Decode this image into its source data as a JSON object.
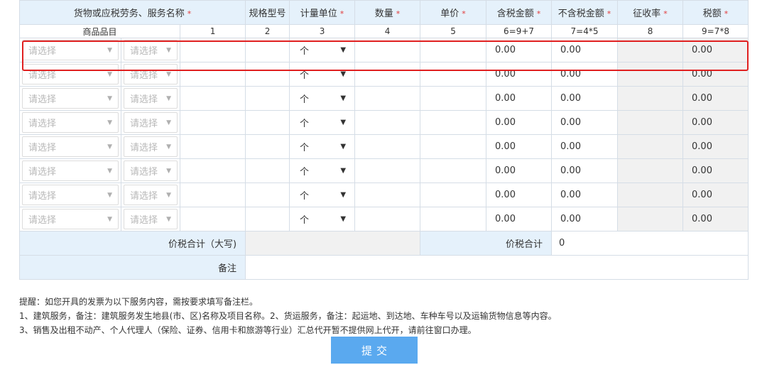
{
  "headers": [
    {
      "label": "货物或应税劳务、服务名称",
      "required": true
    },
    {
      "label": "规格型号",
      "required": false
    },
    {
      "label": "计量单位",
      "required": true
    },
    {
      "label": "数量",
      "required": true
    },
    {
      "label": "单价",
      "required": true
    },
    {
      "label": "含税金额",
      "required": true
    },
    {
      "label": "不含税金额",
      "required": true
    },
    {
      "label": "征收率",
      "required": true
    },
    {
      "label": "税额",
      "required": true
    }
  ],
  "required_mark": "*",
  "index_row": [
    "商品品目",
    "1",
    "2",
    "3",
    "4",
    "5",
    "6=9+7",
    "7=4*5",
    "8",
    "9=7*8"
  ],
  "rows": [
    {
      "cat1": "请选择",
      "cat2": "请选择",
      "unit": "个",
      "tax_incl": "0.00",
      "tax_excl": "0.00",
      "tax": "0.00"
    },
    {
      "cat1": "请选择",
      "cat2": "请选择",
      "unit": "个",
      "tax_incl": "0.00",
      "tax_excl": "0.00",
      "tax": "0.00"
    },
    {
      "cat1": "请选择",
      "cat2": "请选择",
      "unit": "个",
      "tax_incl": "0.00",
      "tax_excl": "0.00",
      "tax": "0.00"
    },
    {
      "cat1": "请选择",
      "cat2": "请选择",
      "unit": "个",
      "tax_incl": "0.00",
      "tax_excl": "0.00",
      "tax": "0.00"
    },
    {
      "cat1": "请选择",
      "cat2": "请选择",
      "unit": "个",
      "tax_incl": "0.00",
      "tax_excl": "0.00",
      "tax": "0.00"
    },
    {
      "cat1": "请选择",
      "cat2": "请选择",
      "unit": "个",
      "tax_incl": "0.00",
      "tax_excl": "0.00",
      "tax": "0.00"
    },
    {
      "cat1": "请选择",
      "cat2": "请选择",
      "unit": "个",
      "tax_incl": "0.00",
      "tax_excl": "0.00",
      "tax": "0.00"
    },
    {
      "cat1": "请选择",
      "cat2": "请选择",
      "unit": "个",
      "tax_incl": "0.00",
      "tax_excl": "0.00",
      "tax": "0.00"
    }
  ],
  "totals": {
    "uppercase_label": "价税合计（大写)",
    "total_label": "价税合计",
    "total_value": "0"
  },
  "remark_label": "备注",
  "notes": [
    "提醒：如您开具的发票为以下服务内容，需按要求填写备注栏。",
    "1、建筑服务，备注：建筑服务发生地县(市、区)名称及项目名称。2、货运服务，备注：起运地、到达地、车种车号以及运输货物信息等内容。",
    "3、销售及出租不动产、个人代理人（保险、证券、信用卡和旅游等行业）汇总代开暂不提供网上代开，请前往窗口办理。"
  ],
  "submit_label": "提交",
  "colors": {
    "header_bg": "#e5f1fb",
    "required": "#e23c3c",
    "submit_bg": "#5aa9ef",
    "highlight": "#e02020"
  }
}
